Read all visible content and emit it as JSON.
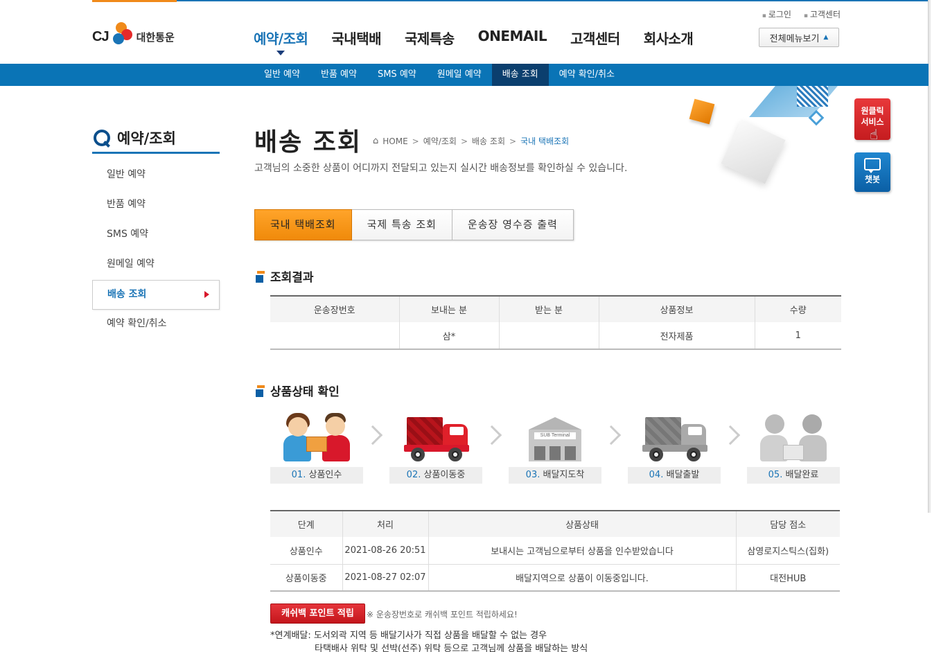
{
  "header": {
    "logo_cj": "CJ",
    "logo_name": "대한통운",
    "top_links": [
      "로그인",
      "고객센터"
    ],
    "gnb": [
      "예약/조회",
      "국내택배",
      "국제특송",
      "ONEMAIL",
      "고객센터",
      "회사소개"
    ],
    "allmenu_label": "전체메뉴보기",
    "allmenu_arrow": "▲"
  },
  "subnav": [
    "일반 예약",
    "반품 예약",
    "SMS 예약",
    "원메일 예약",
    "배송 조회",
    "예약 확인/취소"
  ],
  "sidebar": {
    "title": "예약/조회",
    "items": [
      "일반 예약",
      "반품 예약",
      "SMS 예약",
      "원메일 예약",
      "배송 조회",
      "예약 확인/취소"
    ]
  },
  "page": {
    "title": "배송 조회",
    "breadcrumb": [
      "HOME",
      "예약/조회",
      "배송 조회",
      "국내 택배조회"
    ],
    "breadcrumb_sep": ">",
    "desc": "고객님의 소중한 상품이 어디까지 전달되고 있는지 실시간 배송정보를 확인하실 수 있습니다."
  },
  "float": {
    "oneclick_line1": "원클릭",
    "oneclick_line2": "서비스",
    "chatbot": "챗봇"
  },
  "tabs": [
    "국내 택배조회",
    "국제 특송 조회",
    "운송장 영수증 출력"
  ],
  "result": {
    "title": "조회결과",
    "headers": [
      "운송장번호",
      "보내는 분",
      "받는 분",
      "상품정보",
      "수량"
    ],
    "row": [
      "",
      "삼*",
      "",
      "전자제품",
      "1"
    ]
  },
  "status": {
    "title": "상품상태 확인",
    "steps": [
      {
        "num": "01.",
        "label": "상품인수"
      },
      {
        "num": "02.",
        "label": "상품이동중"
      },
      {
        "num": "03.",
        "label": "배달지도착"
      },
      {
        "num": "04.",
        "label": "배달출발"
      },
      {
        "num": "05.",
        "label": "배달완료"
      }
    ],
    "terminal_sign": "SUB Terminal",
    "headers": [
      "단계",
      "처리",
      "상품상태",
      "담당 점소"
    ],
    "rows": [
      [
        "상품인수",
        "2021-08-26 20:51",
        "보내시는 고객님으로부터 상품을 인수받았습니다",
        "삼영로지스틱스(집화)"
      ],
      [
        "상품이동중",
        "2021-08-27 02:07",
        "배달지역으로 상품이 이동중입니다.",
        "대전HUB"
      ]
    ]
  },
  "cashback": {
    "button": "캐쉬백 포인트 적립",
    "note": "※ 운송장번호로 캐쉬백 포인트 적립하세요!"
  },
  "notes": {
    "line1": "*연계배달: 도서외곽 지역 등 배달기사가 직접 상품을 배달할 수 없는 경우",
    "line2": "타택배사 위탁 및 선박(선주) 위탁 등으로 고객님께 상품을 배달하는 방식"
  },
  "colors": {
    "brand_blue": "#0a74b6",
    "brand_orange": "#f08a1a",
    "accent_red": "#d8182b"
  }
}
